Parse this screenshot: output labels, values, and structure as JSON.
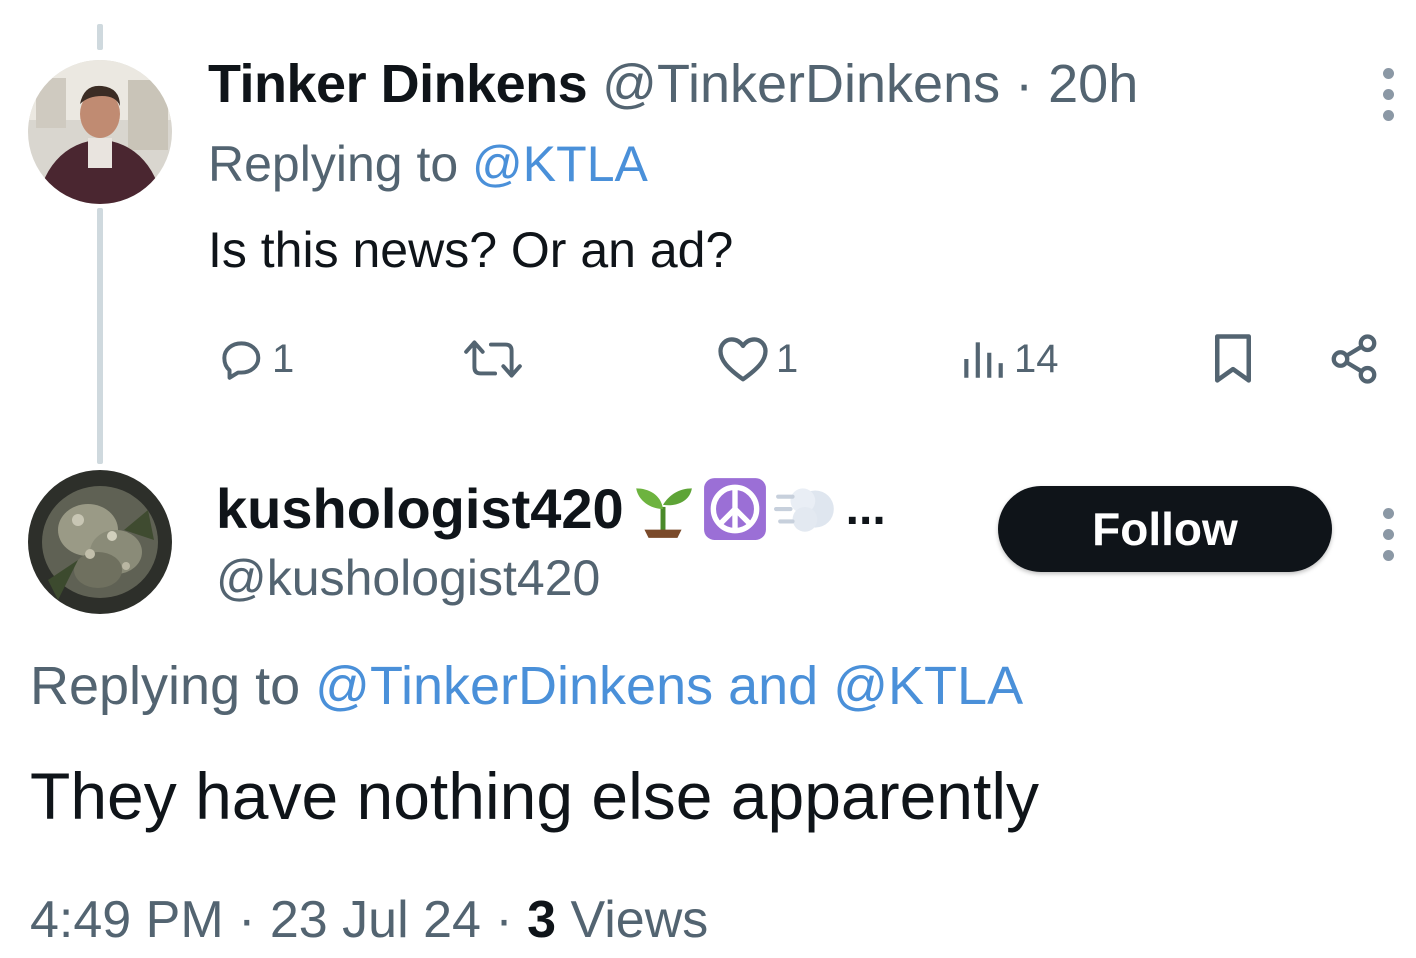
{
  "tweet1": {
    "display_name": "Tinker Dinkens",
    "handle": "@TinkerDinkens",
    "separator": "·",
    "time": "20h",
    "replying_prefix": "Replying to ",
    "replying_to": "@KTLA",
    "text": "Is this news? Or an ad?",
    "actions": {
      "reply_icon": "reply-icon",
      "reply_count": "1",
      "retweet_icon": "retweet-icon",
      "retweet_count": "",
      "like_icon": "heart-icon",
      "like_count": "1",
      "views_icon": "views-icon",
      "views_count": "14",
      "bookmark_icon": "bookmark-icon",
      "share_icon": "share-icon"
    }
  },
  "tweet2": {
    "display_name": "kushologist420",
    "emojis": [
      "seedling-emoji",
      "peace-symbol-emoji",
      "dashing-away-emoji"
    ],
    "ellipsis": "...",
    "handle": "@kushologist420",
    "follow_label": "Follow",
    "replying_prefix": "Replying to ",
    "replying_user1": "@TinkerDinkens",
    "replying_and": " and ",
    "replying_user2": "@KTLA",
    "text": "They have nothing else apparently",
    "time": "4:49 PM",
    "dot": " · ",
    "date": "23 Jul 24",
    "views_count": "3",
    "views_label": " Views"
  },
  "colors": {
    "text": "#0f1419",
    "muted": "#536471",
    "link": "#4a90d9",
    "thread_line": "#cfd9de",
    "follow_bg": "#0f1419"
  }
}
